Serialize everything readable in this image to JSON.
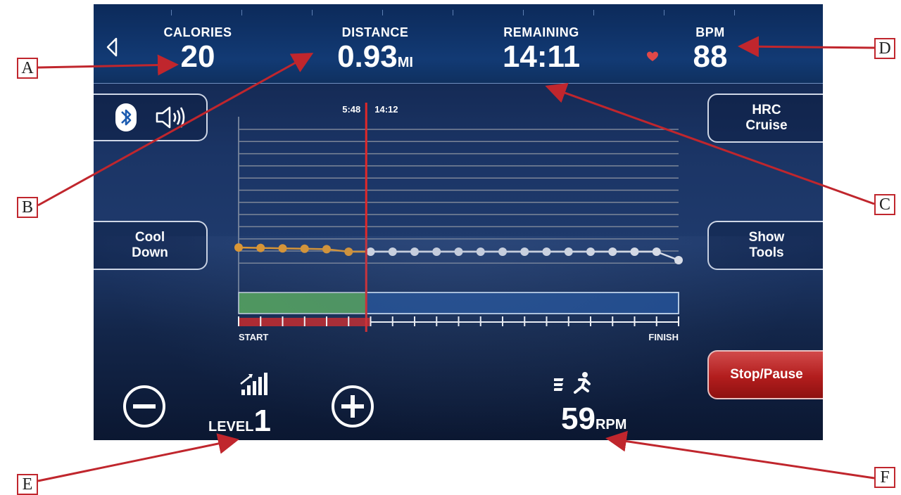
{
  "metrics": {
    "calories": {
      "label": "CALORIES",
      "value": "20"
    },
    "distance": {
      "label": "DISTANCE",
      "value": "0.93",
      "unit": "MI"
    },
    "remaining": {
      "label": "REMAINING",
      "value": "14:11"
    },
    "bpm": {
      "label": "BPM",
      "value": "88"
    }
  },
  "buttons": {
    "hrc": "HRC\nCruise",
    "cool_down": "Cool\nDown",
    "show_tools": "Show\nTools",
    "stop_pause": "Stop/Pause"
  },
  "progress": {
    "elapsed_time": "5:48",
    "total_time": "14:12",
    "start_label": "START",
    "finish_label": "FINISH",
    "completed_fraction": 0.29
  },
  "level": {
    "label": "LEVEL",
    "value": "1"
  },
  "rpm": {
    "value": "59",
    "unit": "RPM"
  },
  "callouts": [
    "A",
    "B",
    "C",
    "D",
    "E",
    "F"
  ],
  "colors": {
    "accent_red": "#c0262d",
    "completed_green": "#4f9a5a",
    "remaining_blue": "#1f4a8c",
    "past_profile": "#e89a2a",
    "future_profile": "#e6e8ee",
    "heart": "#e04848"
  },
  "icons": [
    "back-arrow-icon",
    "bluetooth-icon",
    "speaker-icon",
    "heart-icon",
    "minus-icon",
    "plus-icon",
    "level-bars-icon",
    "runner-speed-icon"
  ]
}
